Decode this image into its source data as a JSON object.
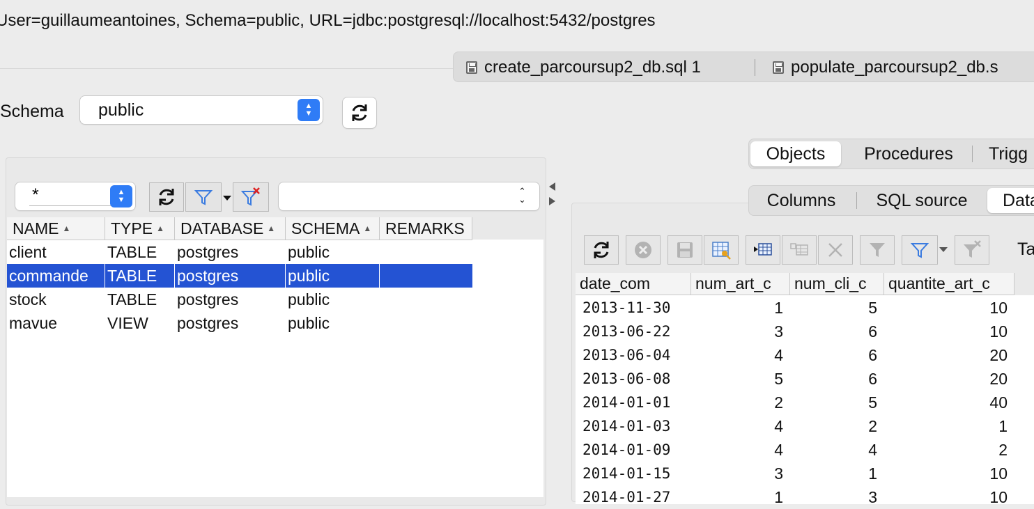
{
  "connection": {
    "text": "User=guillaumeantoines, Schema=public, URL=jdbc:postgresql://localhost:5432/postgres"
  },
  "file_tabs": [
    {
      "label": "create_parcoursup2_db.sql 1"
    },
    {
      "label": "populate_parcoursup2_db.s"
    }
  ],
  "schema": {
    "label": "Schema",
    "value": "public"
  },
  "object_tabs": [
    {
      "label": "Objects",
      "active": true
    },
    {
      "label": "Procedures"
    },
    {
      "label": "Trigg"
    }
  ],
  "filter": {
    "value": "*"
  },
  "objects_table": {
    "columns": [
      "NAME",
      "TYPE",
      "DATABASE",
      "SCHEMA",
      "REMARKS"
    ],
    "rows": [
      {
        "name": "client",
        "type": "TABLE",
        "database": "postgres",
        "schema": "public",
        "remarks": ""
      },
      {
        "name": "commande",
        "type": "TABLE",
        "database": "postgres",
        "schema": "public",
        "remarks": "",
        "selected": true
      },
      {
        "name": "stock",
        "type": "TABLE",
        "database": "postgres",
        "schema": "public",
        "remarks": ""
      },
      {
        "name": "mavue",
        "type": "VIEW",
        "database": "postgres",
        "schema": "public",
        "remarks": ""
      }
    ]
  },
  "detail_tabs": [
    {
      "label": "Columns"
    },
    {
      "label": "SQL source"
    },
    {
      "label": "Data",
      "active": true
    }
  ],
  "data_toolbar": {
    "trailing_label": "Ta"
  },
  "data_table": {
    "columns": [
      "date_com",
      "num_art_c",
      "num_cli_c",
      "quantite_art_c"
    ],
    "rows": [
      [
        "2013-11-30",
        "1",
        "5",
        "10"
      ],
      [
        "2013-06-22",
        "3",
        "6",
        "10"
      ],
      [
        "2013-06-04",
        "4",
        "6",
        "20"
      ],
      [
        "2013-06-08",
        "5",
        "6",
        "20"
      ],
      [
        "2014-01-01",
        "2",
        "5",
        "40"
      ],
      [
        "2014-01-03",
        "4",
        "2",
        "1"
      ],
      [
        "2014-01-09",
        "4",
        "4",
        "2"
      ],
      [
        "2014-01-15",
        "3",
        "1",
        "10"
      ],
      [
        "2014-01-27",
        "1",
        "3",
        "10"
      ]
    ]
  },
  "colors": {
    "selection": "#2453d3",
    "accent": "#2f7cf6"
  }
}
